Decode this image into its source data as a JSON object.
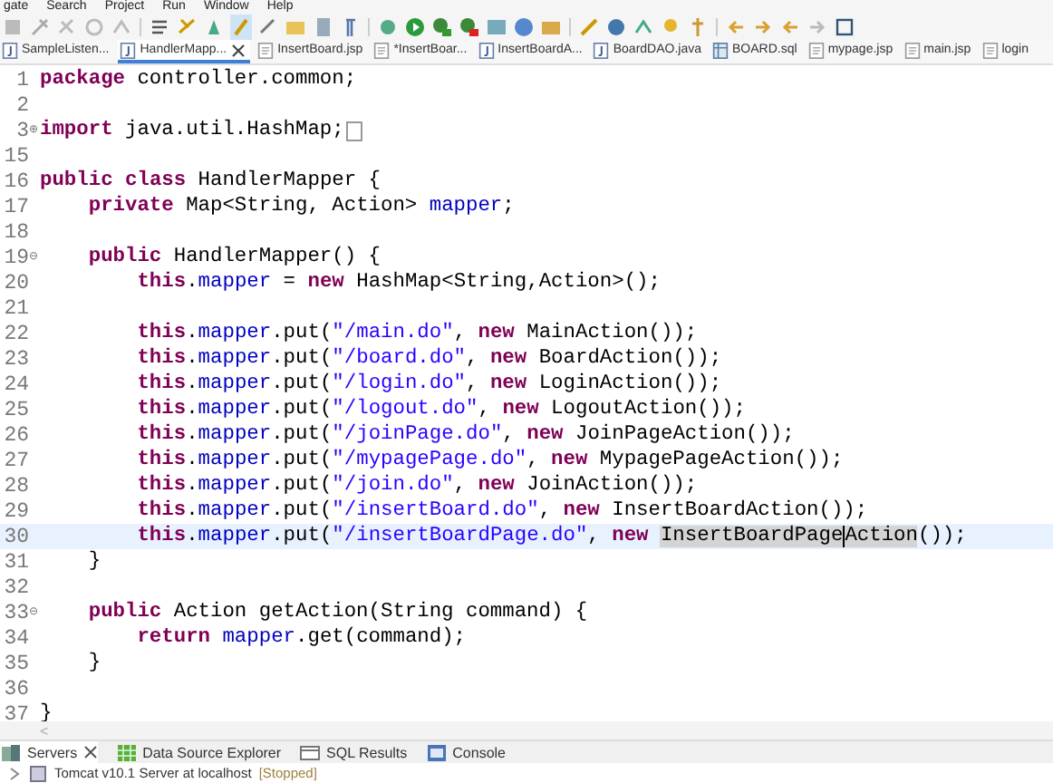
{
  "menu": [
    "gate",
    "Search",
    "Project",
    "Run",
    "Window",
    "Help"
  ],
  "editor_tabs": [
    {
      "label": "SampleListen...",
      "selected": false,
      "kind": "java"
    },
    {
      "label": "HandlerMapp...",
      "selected": true,
      "kind": "java",
      "closable": true
    },
    {
      "label": "InsertBoard.jsp",
      "selected": false,
      "kind": "jsp"
    },
    {
      "label": "*InsertBoar...",
      "selected": false,
      "kind": "jsp"
    },
    {
      "label": "InsertBoardA...",
      "selected": false,
      "kind": "java"
    },
    {
      "label": "BoardDAO.java",
      "selected": false,
      "kind": "java"
    },
    {
      "label": "BOARD.sql",
      "selected": false,
      "kind": "sql"
    },
    {
      "label": "mypage.jsp",
      "selected": false,
      "kind": "jsp"
    },
    {
      "label": "main.jsp",
      "selected": false,
      "kind": "jsp"
    },
    {
      "label": "login",
      "selected": false,
      "kind": "jsp"
    }
  ],
  "code_lines": [
    {
      "number": "1",
      "tokens": [
        {
          "kind": "keyword",
          "text": "package"
        },
        {
          "kind": "plain",
          "text": " controller.common;"
        }
      ]
    },
    {
      "number": "2"
    },
    {
      "number": "3",
      "fold_marker": "⊕",
      "tokens": [
        {
          "kind": "keyword",
          "text": "import"
        },
        {
          "kind": "plain",
          "text": " java.util.HashMap;"
        },
        {
          "kind": "folded"
        }
      ]
    },
    {
      "number": "15"
    },
    {
      "number": "16",
      "tokens": [
        {
          "kind": "keyword",
          "text": "public"
        },
        {
          "kind": "keyword",
          "text": " class"
        },
        {
          "kind": "plain",
          "text": " HandlerMapper {"
        }
      ]
    },
    {
      "number": "17",
      "tokens": [
        {
          "kind": "keyword",
          "text": "    private"
        },
        {
          "kind": "plain",
          "text": " Map<String, Action> "
        },
        {
          "kind": "field",
          "text": "mapper"
        },
        {
          "kind": "plain",
          "text": ";"
        }
      ]
    },
    {
      "number": "18"
    },
    {
      "number": "19",
      "fold_marker": "⊖",
      "tokens": [
        {
          "kind": "keyword",
          "text": "    public"
        },
        {
          "kind": "plain",
          "text": " HandlerMapper() {"
        }
      ]
    },
    {
      "number": "20",
      "tokens": [
        {
          "kind": "keyword",
          "text": "        this"
        },
        {
          "kind": "plain",
          "text": "."
        },
        {
          "kind": "field",
          "text": "mapper"
        },
        {
          "kind": "plain",
          "text": " = "
        },
        {
          "kind": "keyword",
          "text": "new"
        },
        {
          "kind": "plain",
          "text": " HashMap<String,Action>();"
        }
      ]
    },
    {
      "number": "21"
    },
    {
      "number": "22",
      "tokens": [
        {
          "kind": "keyword",
          "text": "        this"
        },
        {
          "kind": "plain",
          "text": "."
        },
        {
          "kind": "field",
          "text": "mapper"
        },
        {
          "kind": "plain",
          "text": ".put("
        },
        {
          "kind": "string",
          "text": "\"/main.do\""
        },
        {
          "kind": "plain",
          "text": ", "
        },
        {
          "kind": "keyword",
          "text": "new"
        },
        {
          "kind": "plain",
          "text": " MainAction());"
        }
      ]
    },
    {
      "number": "23",
      "tokens": [
        {
          "kind": "keyword",
          "text": "        this"
        },
        {
          "kind": "plain",
          "text": "."
        },
        {
          "kind": "field",
          "text": "mapper"
        },
        {
          "kind": "plain",
          "text": ".put("
        },
        {
          "kind": "string",
          "text": "\"/board.do\""
        },
        {
          "kind": "plain",
          "text": ", "
        },
        {
          "kind": "keyword",
          "text": "new"
        },
        {
          "kind": "plain",
          "text": " BoardAction());"
        }
      ]
    },
    {
      "number": "24",
      "tokens": [
        {
          "kind": "keyword",
          "text": "        this"
        },
        {
          "kind": "plain",
          "text": "."
        },
        {
          "kind": "field",
          "text": "mapper"
        },
        {
          "kind": "plain",
          "text": ".put("
        },
        {
          "kind": "string",
          "text": "\"/login.do\""
        },
        {
          "kind": "plain",
          "text": ", "
        },
        {
          "kind": "keyword",
          "text": "new"
        },
        {
          "kind": "plain",
          "text": " LoginAction());"
        }
      ]
    },
    {
      "number": "25",
      "tokens": [
        {
          "kind": "keyword",
          "text": "        this"
        },
        {
          "kind": "plain",
          "text": "."
        },
        {
          "kind": "field",
          "text": "mapper"
        },
        {
          "kind": "plain",
          "text": ".put("
        },
        {
          "kind": "string",
          "text": "\"/logout.do\""
        },
        {
          "kind": "plain",
          "text": ", "
        },
        {
          "kind": "keyword",
          "text": "new"
        },
        {
          "kind": "plain",
          "text": " LogoutAction());"
        }
      ]
    },
    {
      "number": "26",
      "tokens": [
        {
          "kind": "keyword",
          "text": "        this"
        },
        {
          "kind": "plain",
          "text": "."
        },
        {
          "kind": "field",
          "text": "mapper"
        },
        {
          "kind": "plain",
          "text": ".put("
        },
        {
          "kind": "string",
          "text": "\"/joinPage.do\""
        },
        {
          "kind": "plain",
          "text": ", "
        },
        {
          "kind": "keyword",
          "text": "new"
        },
        {
          "kind": "plain",
          "text": " JoinPageAction());"
        }
      ]
    },
    {
      "number": "27",
      "tokens": [
        {
          "kind": "keyword",
          "text": "        this"
        },
        {
          "kind": "plain",
          "text": "."
        },
        {
          "kind": "field",
          "text": "mapper"
        },
        {
          "kind": "plain",
          "text": ".put("
        },
        {
          "kind": "string",
          "text": "\"/mypagePage.do\""
        },
        {
          "kind": "plain",
          "text": ", "
        },
        {
          "kind": "keyword",
          "text": "new"
        },
        {
          "kind": "plain",
          "text": " MypagePageAction());"
        }
      ]
    },
    {
      "number": "28",
      "tokens": [
        {
          "kind": "keyword",
          "text": "        this"
        },
        {
          "kind": "plain",
          "text": "."
        },
        {
          "kind": "field",
          "text": "mapper"
        },
        {
          "kind": "plain",
          "text": ".put("
        },
        {
          "kind": "string",
          "text": "\"/join.do\""
        },
        {
          "kind": "plain",
          "text": ", "
        },
        {
          "kind": "keyword",
          "text": "new"
        },
        {
          "kind": "plain",
          "text": " JoinAction());"
        }
      ]
    },
    {
      "number": "29",
      "tokens": [
        {
          "kind": "keyword",
          "text": "        this"
        },
        {
          "kind": "plain",
          "text": "."
        },
        {
          "kind": "field",
          "text": "mapper"
        },
        {
          "kind": "plain",
          "text": ".put("
        },
        {
          "kind": "string",
          "text": "\"/insertBoard.do\""
        },
        {
          "kind": "plain",
          "text": ", "
        },
        {
          "kind": "keyword",
          "text": "new"
        },
        {
          "kind": "plain",
          "text": " InsertBoardAction());"
        }
      ]
    },
    {
      "number": "30",
      "current": true,
      "tokens": [
        {
          "kind": "keyword",
          "text": "        this"
        },
        {
          "kind": "plain",
          "text": "."
        },
        {
          "kind": "field",
          "text": "mapper"
        },
        {
          "kind": "plain",
          "text": ".put("
        },
        {
          "kind": "string",
          "text": "\"/insertBoardPage.do\""
        },
        {
          "kind": "plain",
          "text": ", "
        },
        {
          "kind": "keyword",
          "text": "new "
        },
        {
          "kind": "occurrence",
          "text": "InsertBoardPage",
          "caret": true
        },
        {
          "kind": "occurrence",
          "text": "Action"
        },
        {
          "kind": "plain",
          "text": "());"
        }
      ]
    },
    {
      "number": "31",
      "tokens": [
        {
          "kind": "plain",
          "text": "    }"
        }
      ]
    },
    {
      "number": "32"
    },
    {
      "number": "33",
      "fold_marker": "⊖",
      "tokens": [
        {
          "kind": "keyword",
          "text": "    public"
        },
        {
          "kind": "plain",
          "text": " Action getAction(String command) {"
        }
      ]
    },
    {
      "number": "34",
      "tokens": [
        {
          "kind": "keyword",
          "text": "        return "
        },
        {
          "kind": "field",
          "text": "mapper"
        },
        {
          "kind": "plain",
          "text": ".get(command);"
        }
      ]
    },
    {
      "number": "35",
      "tokens": [
        {
          "kind": "plain",
          "text": "    }"
        }
      ]
    },
    {
      "number": "36"
    },
    {
      "number": "37",
      "tokens": [
        {
          "kind": "plain",
          "text": "}"
        }
      ]
    }
  ],
  "scroll_arrow": "<",
  "bottom_tabs": [
    {
      "label": "Servers",
      "selected": true,
      "closable": true,
      "kind": "servers"
    },
    {
      "label": "Data Source Explorer",
      "selected": false,
      "kind": "datasource"
    },
    {
      "label": "SQL Results",
      "selected": false,
      "kind": "sql"
    },
    {
      "label": "Console",
      "selected": false,
      "kind": "console"
    }
  ],
  "server_row": {
    "name": "Tomcat v10.1 Server at localhost",
    "status": "[Stopped]"
  }
}
